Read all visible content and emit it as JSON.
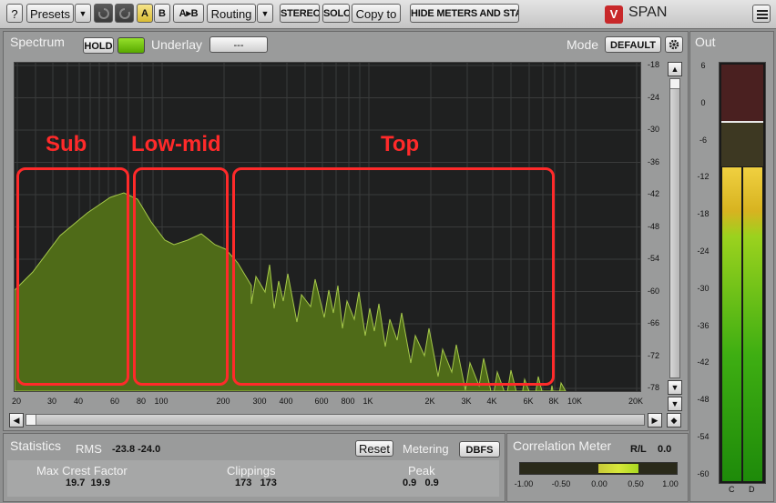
{
  "toolbar": {
    "help_label": "?",
    "presets_label": "Presets",
    "dropdown_arrow": "▼",
    "a_label": "A",
    "b_label": "B",
    "ab_label": "A▸B",
    "routing_label": "Routing",
    "stereo_label": "STEREO",
    "solo_label": "SOLO",
    "copy_label": "Copy to",
    "hide_label": "HIDE METERS AND STATS",
    "brand": "SPAN",
    "logo_glyph": "V"
  },
  "spectrum": {
    "title": "Spectrum",
    "hold_label": "HOLD",
    "underlay_label": "Underlay",
    "underlay_value": "---",
    "mode_label": "Mode",
    "mode_value": "DEFAULT",
    "x_ticks": [
      "20",
      "30",
      "40",
      "60",
      "80",
      "100",
      "200",
      "300",
      "400",
      "600",
      "800",
      "1K",
      "2K",
      "3K",
      "4K",
      "6K",
      "8K",
      "10K",
      "20K"
    ],
    "y_ticks": [
      "-18",
      "-24",
      "-30",
      "-36",
      "-42",
      "-48",
      "-54",
      "-60",
      "-66",
      "-72",
      "-78"
    ],
    "regions": [
      {
        "label": "Sub"
      },
      {
        "label": "Low-mid"
      },
      {
        "label": "Top"
      }
    ]
  },
  "out": {
    "title": "Out",
    "scale": [
      "6",
      "0",
      "-6",
      "-12",
      "-18",
      "-24",
      "-30",
      "-36",
      "-42",
      "-48",
      "-54",
      "-60"
    ],
    "channel_labels": [
      "C",
      "D"
    ]
  },
  "stats": {
    "title": "Statistics",
    "rms_label": "RMS",
    "rms_value": "-23.8 -24.0",
    "reset_label": "Reset",
    "metering_label": "Metering",
    "metering_value": "DBFS",
    "crest_label": "Max Crest Factor",
    "crest_values": "19.7  19.9",
    "clip_label": "Clippings",
    "clip_values": "173   173",
    "peak_label": "Peak",
    "peak_values": "0.9   0.9"
  },
  "correlation": {
    "title": "Correlation Meter",
    "rl_label": "R/L",
    "rl_value": "0.0",
    "scale": [
      "-1.00",
      "-0.50",
      "0.00",
      "0.50",
      "1.00"
    ]
  },
  "colors": {
    "accent_green": "#6ec800",
    "region_red": "#ff2a2a",
    "spectrum_fill": "#4f6b18",
    "meter_yellow": "#e7c21d"
  }
}
